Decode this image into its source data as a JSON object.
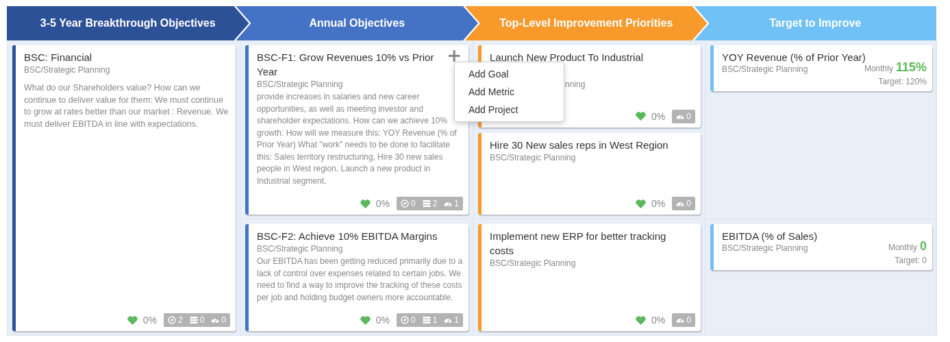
{
  "stages": [
    {
      "label": "3-5 Year Breakthrough Objectives",
      "color": "#2d5196"
    },
    {
      "label": "Annual Objectives",
      "color": "#4472c4"
    },
    {
      "label": "Top-Level Improvement Priorities",
      "color": "#f7992b"
    },
    {
      "label": "Target to Improve",
      "color": "#70c1f5"
    }
  ],
  "breakthrough": {
    "title": "BSC: Financial",
    "subtitle": "BSC/Strategic Planning",
    "description": "What do our Shareholders value? How can we continue to deliver value for them: We must continue to grow at rates better than our market : Revenue. We must deliver EBITDA in line with expectations.",
    "health": "0%",
    "counts": [
      {
        "kind": "goals",
        "value": "2"
      },
      {
        "kind": "projects",
        "value": "0"
      },
      {
        "kind": "metrics",
        "value": "0"
      }
    ]
  },
  "rows": [
    {
      "objective": {
        "title": "BSC-F1: Grow Revenues 10% vs Prior Year",
        "subtitle": "BSC/Strategic Planning",
        "description": "provide increases in salaries and new career opportunities, as well as meeting investor and shareholder expectations. How can we achieve 10% growth: How will we measure this: YOY Revenue (% of Prior Year) What \"work\" needs to be done to facilitate this: Sales territory restructuring, Hire 30 new sales people in West region. Launch a new product in Industrial segment.",
        "health": "0%",
        "counts": [
          {
            "kind": "goals",
            "value": "0"
          },
          {
            "kind": "projects",
            "value": "2"
          },
          {
            "kind": "metrics",
            "value": "1"
          }
        ],
        "add_button": "+",
        "menu": [
          "Add Goal",
          "Add Metric",
          "Add Project"
        ]
      },
      "priorities": [
        {
          "title": "Launch New Product To Industrial",
          "subtitle": "nning",
          "partly_covered": true,
          "health": "0%",
          "counts": [
            {
              "kind": "metrics",
              "value": "0"
            }
          ]
        },
        {
          "title": "Hire 30 New sales reps in West Region",
          "subtitle": "BSC/Strategic Planning",
          "partly_covered": false,
          "health": "0%",
          "counts": [
            {
              "kind": "metrics",
              "value": "0"
            }
          ]
        }
      ],
      "targets": [
        {
          "title": "YOY Revenue (% of Prior Year)",
          "subtitle": "BSC/Strategic Planning",
          "frequency": "Monthly",
          "value": "115%",
          "target": "Target: 120%"
        }
      ]
    },
    {
      "objective": {
        "title": "BSC-F2: Achieve 10% EBITDA Margins",
        "subtitle": "BSC/Strategic Planning",
        "description": "Our EBITDA has been getting reduced primarily due to a lack of control over expenses related to certain jobs. We need to find a way to improve the tracking of these costs per job and holding budget owners more accountable.",
        "health": "0%",
        "counts": [
          {
            "kind": "goals",
            "value": "0"
          },
          {
            "kind": "projects",
            "value": "1"
          },
          {
            "kind": "metrics",
            "value": "1"
          }
        ]
      },
      "priorities": [
        {
          "title": "Implement new ERP for better tracking costs",
          "subtitle": "BSC/Strategic Planning",
          "partly_covered": false,
          "health": "0%",
          "counts": [
            {
              "kind": "metrics",
              "value": "0"
            }
          ]
        }
      ],
      "targets": [
        {
          "title": "EBITDA (% of Sales)",
          "subtitle": "BSC/Strategic Planning",
          "frequency": "Monthly",
          "value": "0",
          "target": "Target: 0"
        }
      ]
    }
  ]
}
